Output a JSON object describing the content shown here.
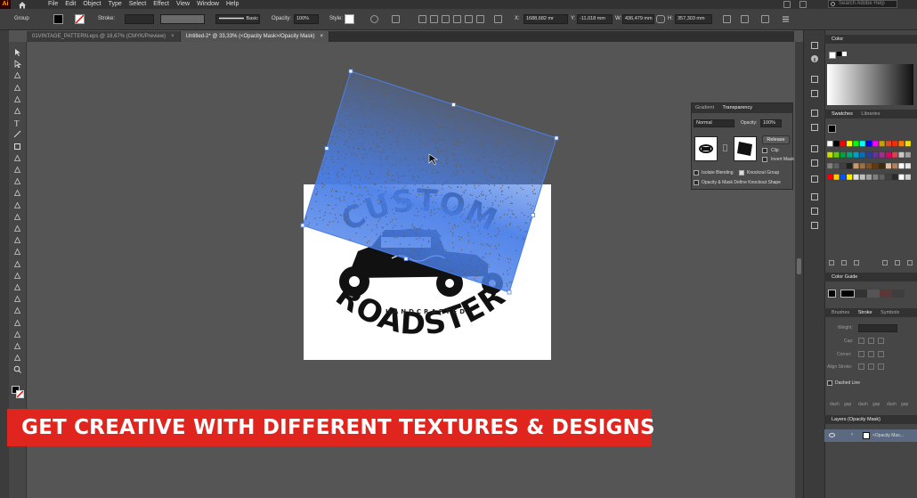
{
  "app": {
    "logo": "Ai",
    "menu": [
      "File",
      "Edit",
      "Object",
      "Type",
      "Select",
      "Effect",
      "View",
      "Window",
      "Help"
    ],
    "search_placeholder": "Search Adobe Help"
  },
  "control_bar": {
    "selection": "Group",
    "stroke_label": "Stroke:",
    "brush_style": "Basic",
    "opacity_label": "Opacity:",
    "opacity_value": "100%",
    "style_label": "Style:",
    "x_label": "X:",
    "x_value": "1688,682 mr",
    "y_label": "Y:",
    "y_value": "-11,018 mm",
    "w_label": "W:",
    "w_value": "436,479 mm",
    "h_label": "H:",
    "h_value": "357,303 mm"
  },
  "tabs": [
    {
      "label": "01VINTAGE_PATTERN.eps @ 16,67% (CMYK/Preview)",
      "close": "×"
    },
    {
      "label": "Untitled-2* @ 33,33% (<Opacity Mask>/Opacity Mask)",
      "close": "×"
    }
  ],
  "artwork": {
    "top_text": "CUSTOM",
    "middle_text": "HANDCRAFTED",
    "bottom_text": "ROADSTER"
  },
  "transparency_panel": {
    "tab_gradient": "Gradient",
    "tab_transparency": "Transparency",
    "blend_mode": "Normal",
    "opacity_label": "Opacity:",
    "opacity_value": "100%",
    "release_button": "Release",
    "clip_label": "Clip",
    "invert_mask_label": "Invert Mask",
    "isolate_blending_label": "Isolate Blending",
    "knockout_group_label": "Knockout Group",
    "opacity_mask_label": "Opacity & Mask Define Knockout Shape"
  },
  "right_panels": {
    "color_title": "Color",
    "swatches_tab": "Swatches",
    "libraries_tab": "Libraries",
    "color_guide_title": "Color Guide",
    "brushes_tab": "Brushes",
    "stroke_tab": "Stroke",
    "symbols_tab": "Symbols",
    "weight_label": "Weight:",
    "cap_label": "Cap:",
    "corner_label": "Corner:",
    "align_stroke_label": "Align Stroke:",
    "dashed_line_label": "Dashed Line",
    "dash_labels": [
      "dash",
      "gap",
      "dash",
      "gap",
      "dash",
      "gap"
    ],
    "layers_title": "Layers (Opacity Mask)",
    "layer_item": "<Opacity Mas..."
  },
  "banner": {
    "text": "GET CREATIVE WITH DIFFERENT TEXTURES & DESIGNS"
  },
  "colors": {
    "selection_blue": "#4a7fe8",
    "banner_red": "#e0241e",
    "canvas_gray": "#555555"
  },
  "swatch_colors": [
    [
      "#ffffff",
      "#000000",
      "#ff0000",
      "#ffff00",
      "#00ff00",
      "#00ffff",
      "#0000ff",
      "#ff00ff",
      "#c8a000",
      "#e8441f",
      "#ff2a00",
      "#ff7a00",
      "#f0e000"
    ],
    [
      "#c8e000",
      "#5fd000",
      "#00a040",
      "#00a87a",
      "#00a0c8",
      "#0070c0",
      "#2a40a0",
      "#6a30a0",
      "#a03090",
      "#e0006a",
      "#e0404a",
      "#c8c8c8",
      "#a0a0a0"
    ],
    [
      "#808080",
      "#606060",
      "#404040",
      "#202020",
      "#c89a6a",
      "#a07040",
      "#805020",
      "#603a10",
      "#40280a",
      "#e0c0a0",
      "#b08060",
      "#ffffff",
      "#e6e6e6"
    ],
    [
      "#ff0000",
      "#ffcc00",
      "#0055ff",
      "#ffee00",
      "#e0e0e0",
      "#c0c0c0",
      "#a0a0a0",
      "#808080",
      "#606060",
      "#404040",
      "#2a2a2a",
      "#ffffff",
      "#d0d0d0"
    ]
  ]
}
